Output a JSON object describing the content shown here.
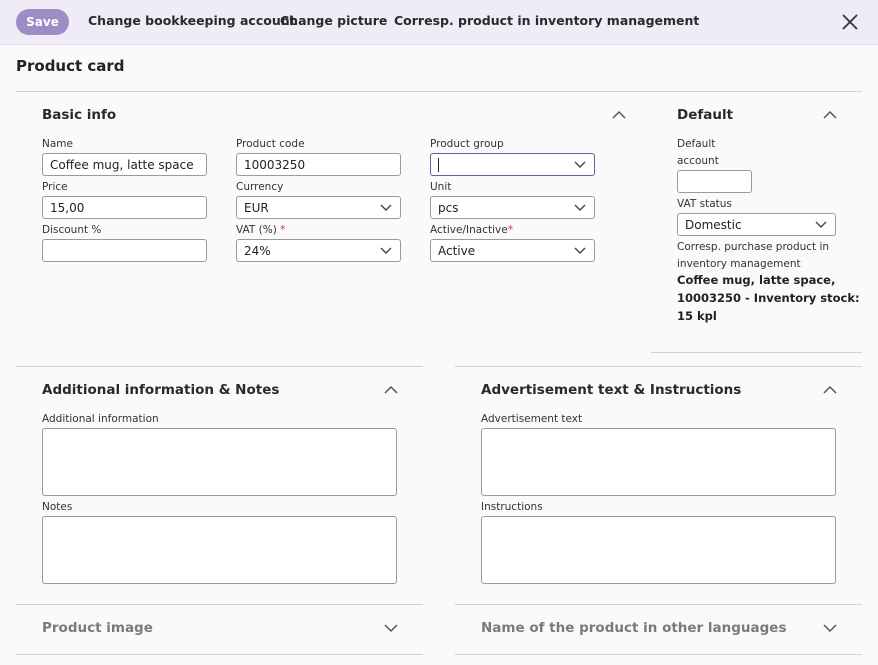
{
  "toolbar": {
    "save_label": "Save",
    "change_account_label": "Change bookkeeping account",
    "change_picture_label": "Change picture",
    "corresp_product_label": "Corresp. product in inventory management"
  },
  "page": {
    "title": "Product card"
  },
  "basic_info": {
    "title": "Basic info",
    "name": {
      "label": "Name",
      "value": "Coffee mug, latte space"
    },
    "product_code": {
      "label": "Product code",
      "value": "10003250"
    },
    "product_group": {
      "label": "Product group",
      "value": ""
    },
    "price": {
      "label": "Price",
      "value": "15,00"
    },
    "currency": {
      "label": "Currency",
      "value": "EUR"
    },
    "unit": {
      "label": "Unit",
      "value": "pcs"
    },
    "discount": {
      "label": "Discount %",
      "value": ""
    },
    "vat": {
      "label": "VAT (%)",
      "required_mark": "*",
      "value": "24%"
    },
    "active": {
      "label": "Active/Inactive",
      "required_mark": "*",
      "value": "Active"
    }
  },
  "default": {
    "title": "Default",
    "account_label_line1": "Default",
    "account_label_line2": "account",
    "account_value": "",
    "vat_status_label": "VAT status",
    "vat_status_value": "Domestic",
    "corresp_label_line1": "Corresp. purchase product in",
    "corresp_label_line2": "inventory management",
    "corresp_value_line1": "Coffee mug, latte space,",
    "corresp_value_line2": "10003250 - Inventory stock:",
    "corresp_value_line3": "15 kpl"
  },
  "additional": {
    "title": "Additional information & Notes",
    "info_label": "Additional information",
    "notes_label": "Notes"
  },
  "advertisement": {
    "title": "Advertisement text & Instructions",
    "ad_label": "Advertisement text",
    "instructions_label": "Instructions"
  },
  "product_image": {
    "title": "Product image"
  },
  "other_languages": {
    "title": "Name of the product in other languages"
  },
  "colors": {
    "accent": "#9d8cc6",
    "toolbar_bg": "#efebf7",
    "required": "#c0392b"
  }
}
